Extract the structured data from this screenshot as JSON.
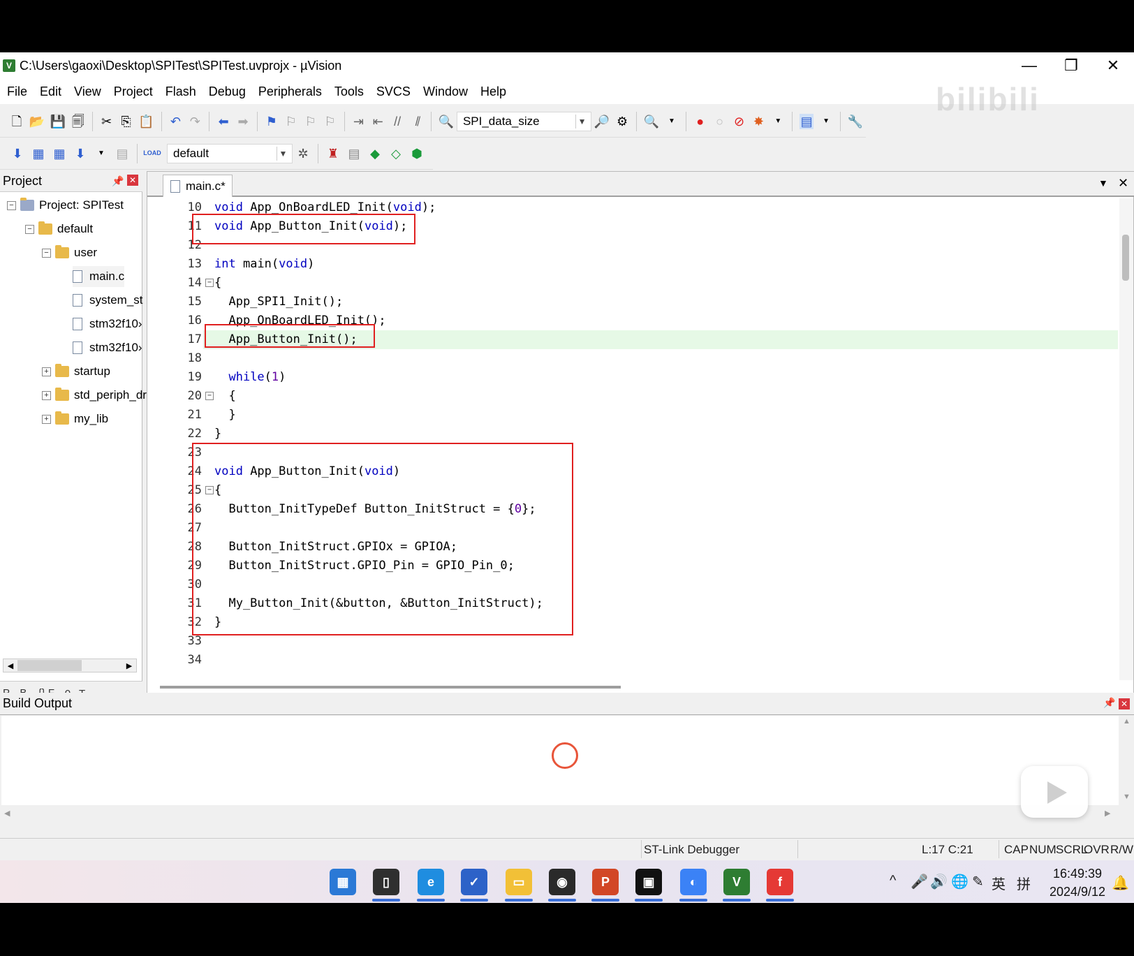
{
  "window": {
    "title": "C:\\Users\\gaoxi\\Desktop\\SPITest\\SPITest.uvprojx - µVision",
    "controls": {
      "minimize": "—",
      "restore": "❐",
      "close": "✕"
    }
  },
  "menu": {
    "items": [
      {
        "label": "File"
      },
      {
        "label": "Edit"
      },
      {
        "label": "View"
      },
      {
        "label": "Project"
      },
      {
        "label": "Flash"
      },
      {
        "label": "Debug"
      },
      {
        "label": "Peripherals"
      },
      {
        "label": "Tools"
      },
      {
        "label": "SVCS"
      },
      {
        "label": "Window"
      },
      {
        "label": "Help"
      }
    ]
  },
  "toolbar1": {
    "find_combo_value": "SPI_data_size"
  },
  "toolbar2": {
    "target_combo_value": "default",
    "load_label": "LOAD"
  },
  "project_panel": {
    "title": "Project",
    "tree": [
      {
        "label": "Project: SPITest",
        "level": 0,
        "kind": "project",
        "toggle": "−"
      },
      {
        "label": "default",
        "level": 1,
        "kind": "folder",
        "toggle": "−"
      },
      {
        "label": "user",
        "level": 2,
        "kind": "folder",
        "toggle": "−"
      },
      {
        "label": "main.c",
        "level": 3,
        "kind": "file"
      },
      {
        "label": "system_st",
        "level": 3,
        "kind": "file"
      },
      {
        "label": "stm32f10›",
        "level": 3,
        "kind": "file"
      },
      {
        "label": "stm32f10›",
        "level": 3,
        "kind": "file"
      },
      {
        "label": "startup",
        "level": 2,
        "kind": "folder",
        "toggle": "+"
      },
      {
        "label": "std_periph_dr",
        "level": 2,
        "kind": "folder",
        "toggle": "+"
      },
      {
        "label": "my_lib",
        "level": 2,
        "kind": "folder",
        "toggle": "+"
      }
    ],
    "bottom_tabs": [
      {
        "label": "P.."
      },
      {
        "label": "B.."
      },
      {
        "label": "{} F.."
      },
      {
        "label": "0₊ T.."
      }
    ]
  },
  "editor": {
    "tab_label": "main.c*",
    "lines": [
      {
        "n": "10",
        "text": "void App_OnBoardLED_Init(void);"
      },
      {
        "n": "11",
        "text": "void App_Button_Init(void);"
      },
      {
        "n": "12",
        "text": ""
      },
      {
        "n": "13",
        "text": "int main(void)"
      },
      {
        "n": "14",
        "text": "{",
        "fold": "−"
      },
      {
        "n": "15",
        "text": "  App_SPI1_Init();"
      },
      {
        "n": "16",
        "text": "  App_OnBoardLED_Init();"
      },
      {
        "n": "17",
        "text": "  App_Button_Init();",
        "current": true
      },
      {
        "n": "18",
        "text": ""
      },
      {
        "n": "19",
        "text": "  while(1)"
      },
      {
        "n": "20",
        "text": "  {",
        "fold": "−"
      },
      {
        "n": "21",
        "text": "  }"
      },
      {
        "n": "22",
        "text": "}"
      },
      {
        "n": "23",
        "text": ""
      },
      {
        "n": "24",
        "text": "void App_Button_Init(void)"
      },
      {
        "n": "25",
        "text": "{",
        "fold": "−"
      },
      {
        "n": "26",
        "text": "  Button_InitTypeDef Button_InitStruct = {0};"
      },
      {
        "n": "27",
        "text": ""
      },
      {
        "n": "28",
        "text": "  Button_InitStruct.GPIOx = GPIOA;"
      },
      {
        "n": "29",
        "text": "  Button_InitStruct.GPIO_Pin = GPIO_Pin_0;"
      },
      {
        "n": "30",
        "text": ""
      },
      {
        "n": "31",
        "text": "  My_Button_Init(&button, &Button_InitStruct);"
      },
      {
        "n": "32",
        "text": "}"
      },
      {
        "n": "33",
        "text": ""
      },
      {
        "n": "34",
        "text": ""
      }
    ],
    "highlight_color": "#e6f9e6",
    "annotation_color": "#e02020"
  },
  "build_output": {
    "title": "Build Output"
  },
  "statusbar": {
    "debugger": "ST-Link Debugger",
    "position": "L:17 C:21",
    "flags": [
      "CAP",
      "NUM",
      "SCRL",
      "OVR",
      "R/W"
    ]
  },
  "taskbar": {
    "apps": [
      {
        "name": "start",
        "color": "#2b79d6",
        "glyph": "▦"
      },
      {
        "name": "files-app",
        "color": "#2f2f2f",
        "glyph": "▯"
      },
      {
        "name": "edge",
        "color": "#1f8de0",
        "glyph": "e"
      },
      {
        "name": "todo",
        "color": "#2d62c8",
        "glyph": "✓"
      },
      {
        "name": "explorer",
        "color": "#f2c037",
        "glyph": "▭"
      },
      {
        "name": "obs",
        "color": "#2a2a2a",
        "glyph": "◉"
      },
      {
        "name": "powerpoint",
        "color": "#d24726",
        "glyph": "P"
      },
      {
        "name": "capture",
        "color": "#111111",
        "glyph": "▣"
      },
      {
        "name": "browser",
        "color": "#3b82f6",
        "glyph": "◐"
      },
      {
        "name": "keil",
        "color": "#2e7d32",
        "glyph": "V"
      },
      {
        "name": "foxit",
        "color": "#e53935",
        "glyph": "f"
      }
    ],
    "tray": [
      "^",
      "🎤",
      "🔊",
      "🌐",
      "✎",
      "英",
      "拼"
    ],
    "time": "16:49:39",
    "date": "2024/9/12"
  },
  "overlay": {
    "watermark": "bilibili"
  }
}
